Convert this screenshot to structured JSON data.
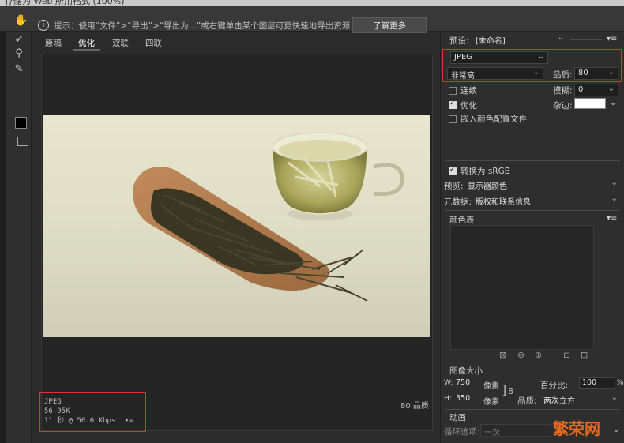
{
  "title_partial": "存储为 Web 所用格式 (100%)",
  "hint": {
    "text": "提示：使用“文件”>“导出”>“导出为...”或右键单击某个图层可更快速地导出资源",
    "button": "了解更多"
  },
  "tools": [
    "hand-icon",
    "slice-select-icon",
    "zoom-icon",
    "eyedropper-icon"
  ],
  "tabs": [
    {
      "label": "原稿"
    },
    {
      "label": "优化"
    },
    {
      "label": "双联"
    },
    {
      "label": "四联"
    }
  ],
  "image_info": {
    "format": "JPEG",
    "size": "56.95K",
    "time": "11 秒 @ 56.6 Kbps",
    "quality_label": "80 品质"
  },
  "settings": {
    "preset_label": "预设:",
    "preset_value": "[未命名]",
    "format": "JPEG",
    "compression": "非常高",
    "quality_label": "品质:",
    "quality_value": "80",
    "progressive_label": "连续",
    "blur_label": "模糊:",
    "blur_value": "0",
    "optimized_label": "优化",
    "matte_label": "杂边:",
    "embed_profile_label": "嵌入颜色配置文件",
    "convert_srgb_label": "转换为 sRGB",
    "preview_label": "预览:",
    "preview_value": "显示器颜色",
    "metadata_label": "元数据:",
    "metadata_value": "版权和联系信息",
    "color_table_label": "颜色表"
  },
  "image_size": {
    "section_label": "图像大小",
    "w_label": "W:",
    "w_value": "750",
    "h_label": "H:",
    "h_value": "350",
    "unit": "像素",
    "percent_label": "百分比:",
    "percent_value": "100",
    "percent_unit": "%",
    "quality_label": "品质:",
    "quality_value": "两次立方"
  },
  "animation": {
    "section_label": "动画",
    "loop_label": "循环选项:",
    "loop_value": "一次"
  },
  "watermark": "繁荣网"
}
